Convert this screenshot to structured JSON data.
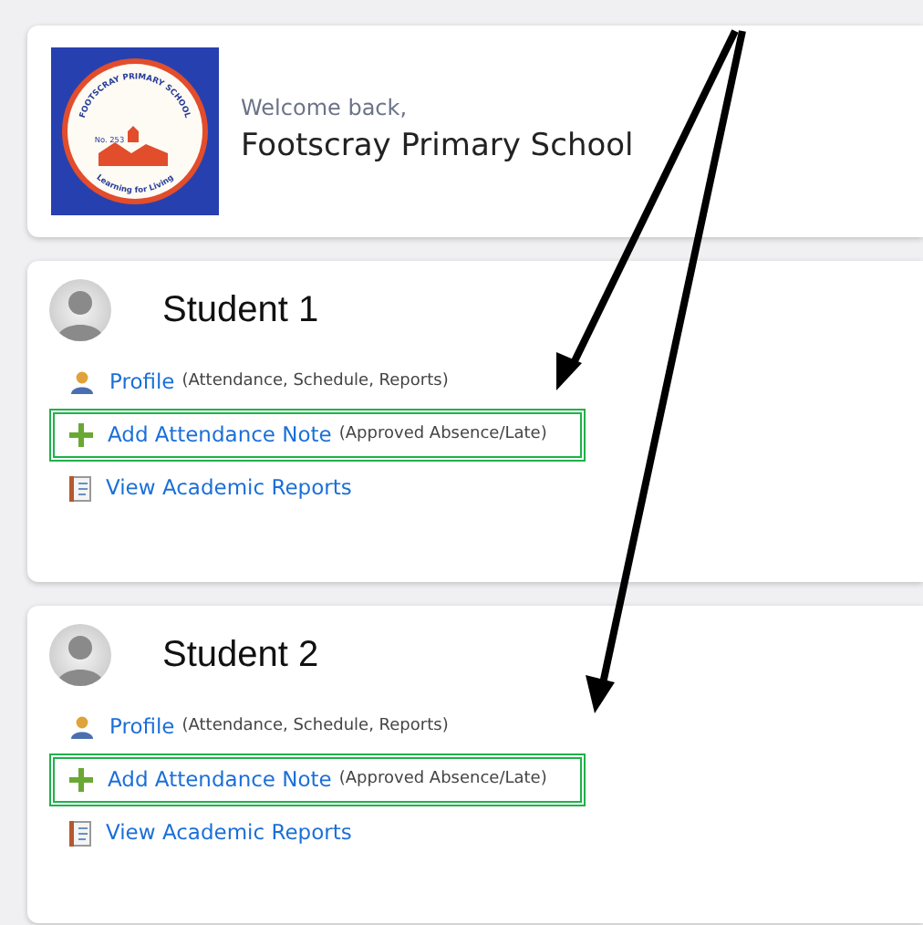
{
  "school": {
    "logo": {
      "ring_text": "FOOTSCRAY PRIMARY SCHOOL",
      "number": "No. 253",
      "motto": "Learning for Living"
    },
    "greeting": "Welcome back,",
    "name": "Footscray Primary School"
  },
  "students": [
    {
      "name": "Student 1",
      "links": [
        {
          "kind": "profile",
          "label": "Profile",
          "note": "(Attendance, Schedule, Reports)",
          "highlighted": false
        },
        {
          "kind": "add",
          "label": "Add Attendance Note",
          "note": "(Approved Absence/Late)",
          "highlighted": true
        },
        {
          "kind": "reports",
          "label": "View Academic Reports",
          "highlighted": false
        }
      ]
    },
    {
      "name": "Student 2",
      "links": [
        {
          "kind": "profile",
          "label": "Profile",
          "note": "(Attendance, Schedule, Reports)",
          "highlighted": false
        },
        {
          "kind": "add",
          "label": "Add Attendance Note",
          "note": "(Approved Absence/Late)",
          "highlighted": true
        },
        {
          "kind": "reports",
          "label": "View Academic Reports",
          "highlighted": false
        }
      ]
    }
  ]
}
